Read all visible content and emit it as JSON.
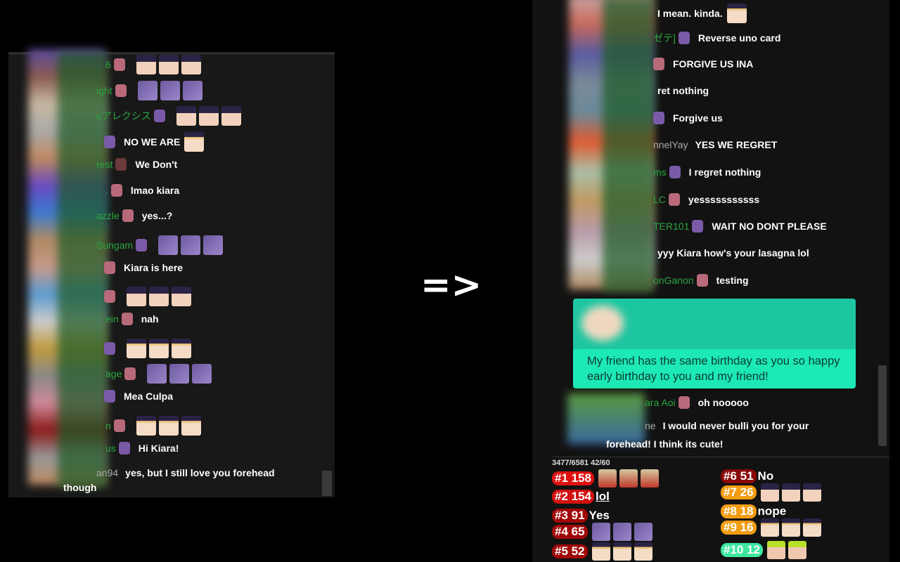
{
  "arrow": "=>",
  "left_chat": [
    {
      "name": "6",
      "badge": "kiara",
      "text": "",
      "emote": "face",
      "n": 3
    },
    {
      "name": "ight",
      "badge": "kiara",
      "text": "",
      "emote": "tako",
      "n": 3
    },
    {
      "name": "oアレクシス",
      "badge": "tako",
      "text": "",
      "emote": "face",
      "n": 3
    },
    {
      "name": "",
      "badge": "tako",
      "text": "NO WE ARE",
      "emote": "gold",
      "n": 1
    },
    {
      "name": "rest",
      "badge": "book",
      "text": "We Don't",
      "emote": "",
      "n": 0
    },
    {
      "name": ".",
      "badge": "kiara",
      "text": "lmao kiara",
      "emote": "",
      "n": 0
    },
    {
      "name": "azzle",
      "badge": "kiara",
      "text": "yes...?",
      "emote": "",
      "n": 0
    },
    {
      "name": "Sungam",
      "badge": "tako",
      "text": "",
      "emote": "tako",
      "n": 3
    },
    {
      "name": "",
      "badge": "kiara",
      "text": "Kiara is here",
      "emote": "",
      "n": 0
    },
    {
      "name": "",
      "badge": "kiara",
      "text": "",
      "emote": "face",
      "n": 3
    },
    {
      "name": "ein",
      "badge": "kiara",
      "text": "nah",
      "emote": "",
      "n": 0
    },
    {
      "name": "",
      "badge": "tako",
      "text": "",
      "emote": "gold",
      "n": 3
    },
    {
      "name": "age",
      "badge": "kiara",
      "text": "",
      "emote": "tako",
      "n": 3
    },
    {
      "name": "",
      "badge": "tako",
      "text": "Mea Culpa",
      "emote": "",
      "n": 0
    },
    {
      "name": "n",
      "badge": "kiara",
      "text": "",
      "emote": "gold",
      "n": 3
    },
    {
      "name": "us",
      "badge": "tako",
      "text": "Hi Kiara!",
      "emote": "",
      "n": 0
    },
    {
      "name": "an94",
      "badge": "",
      "text": "yes, but I still love you forehead",
      "emote": "",
      "n": 0,
      "grey": true
    }
  ],
  "left_wrap": "though",
  "right_chat": [
    {
      "name": "",
      "badge": "",
      "text": "I mean. kinda.",
      "emote": "gold",
      "n": 1
    },
    {
      "name": "ゼテ]",
      "badge": "tako",
      "text": "Reverse uno card",
      "emote": "",
      "n": 0
    },
    {
      "name": "",
      "badge": "kiara",
      "text": "FORGIVE US INA",
      "emote": "",
      "n": 0
    },
    {
      "name": "",
      "badge": "",
      "text": "ret nothing",
      "emote": "",
      "n": 0
    },
    {
      "name": "",
      "badge": "tako",
      "text": "Forgive us",
      "emote": "",
      "n": 0
    },
    {
      "name": "nnelYay",
      "badge": "",
      "text": "YES WE REGRET",
      "emote": "",
      "n": 0,
      "grey": true
    },
    {
      "name": "ms",
      "badge": "tako",
      "text": "I regret nothing",
      "emote": "",
      "n": 0
    },
    {
      "name": "LC",
      "badge": "kiara",
      "text": "yesssssssssss",
      "emote": "",
      "n": 0
    },
    {
      "name": "TER101",
      "badge": "tako",
      "text": "WAIT NO DONT PLEASE",
      "emote": "",
      "n": 0
    },
    {
      "name": "",
      "badge": "",
      "text": "yyy Kiara how's your lasagna lol",
      "emote": "",
      "n": 0
    },
    {
      "name": "onGanon",
      "badge": "kiara",
      "text": "testing",
      "emote": "",
      "n": 0
    }
  ],
  "superchat": {
    "message": "My friend has the same birthday as you so happy early birthday to you and my friend!",
    "color": "#1de9b6"
  },
  "right_after": [
    {
      "name": "ara Aoi",
      "badge": "kiara",
      "text": "oh nooooo",
      "grey": false
    },
    {
      "name": "ne",
      "badge": "",
      "text": "I would never bulli you for your",
      "grey": true
    }
  ],
  "right_wrap": "forehead! I think its cute!",
  "stats_header": "3477/6581 42/60",
  "ranking": [
    {
      "label": "#1 158",
      "text": "",
      "emote": "kusa",
      "n": 3,
      "color": "#e01010"
    },
    {
      "label": "#2 154",
      "text": "lol",
      "emote": "",
      "n": 0,
      "color": "#d01010",
      "underline": true
    },
    {
      "label": "#3 91",
      "text": "Yes",
      "emote": "",
      "n": 0,
      "color": "#a00808"
    },
    {
      "label": "#4 65",
      "text": "",
      "emote": "tako",
      "n": 3,
      "color": "#a00808"
    },
    {
      "label": "#5 52",
      "text": "",
      "emote": "gold",
      "n": 3,
      "color": "#a00808"
    },
    {
      "label": "#6 51",
      "text": "No",
      "emote": "",
      "n": 0,
      "color": "#8a0808"
    },
    {
      "label": "#7 26",
      "text": "",
      "emote": "face",
      "n": 3,
      "color": "#f39c12"
    },
    {
      "label": "#8 18",
      "text": "nope",
      "emote": "",
      "n": 0,
      "color": "#f39c12"
    },
    {
      "label": "#9 16",
      "text": "",
      "emote": "gold",
      "n": 3,
      "color": "#f39c12"
    },
    {
      "label": "#10 12",
      "text": "",
      "emote": "inaff",
      "n": 2,
      "color": "#3ee8a0"
    }
  ]
}
